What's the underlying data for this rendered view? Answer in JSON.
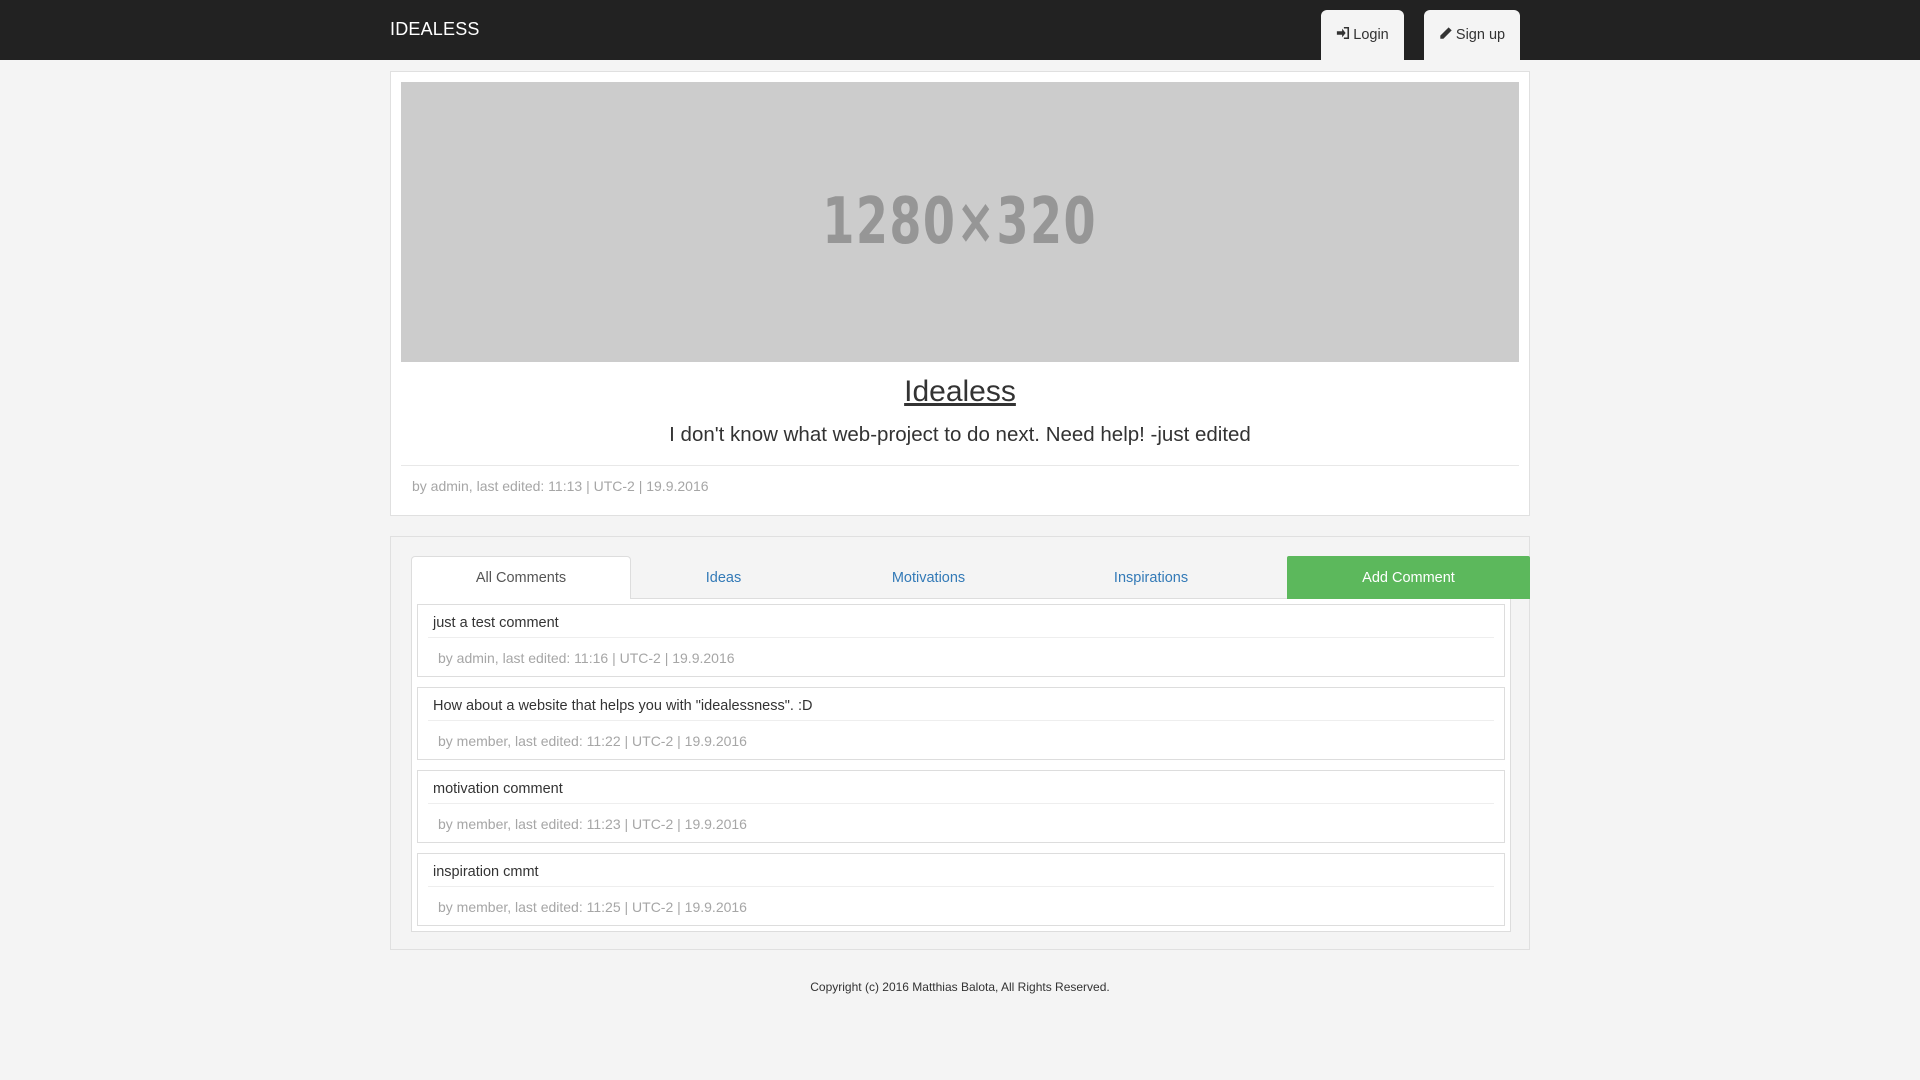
{
  "navbar": {
    "brand": "IDEALESS",
    "login_label": "Login",
    "signup_label": "Sign up",
    "login_icon": "login-icon",
    "signup_icon": "pencil-icon",
    "background": "#222222"
  },
  "idea": {
    "image_placeholder": "1280×320",
    "title": "Idealess",
    "description": "I don't know what web-project to do next. Need help! -just edited",
    "meta": "by admin, last edited: 11:13 | UTC-2 | 19.9.2016"
  },
  "tabs": {
    "items": [
      {
        "label": "All Comments",
        "active": true
      },
      {
        "label": "Ideas",
        "active": false
      },
      {
        "label": "Motivations",
        "active": false
      },
      {
        "label": "Inspirations",
        "active": false
      }
    ],
    "add_comment_label": "Add Comment",
    "add_comment_color": "#5cb85c",
    "link_color": "#337ab7"
  },
  "comments": [
    {
      "text": "just a test comment",
      "meta": "by admin, last edited: 11:16 | UTC-2 | 19.9.2016"
    },
    {
      "text": "How about a website that helps you with \"idealessness\". :D",
      "meta": "by member, last edited: 11:22 | UTC-2 | 19.9.2016"
    },
    {
      "text": "motivation comment",
      "meta": "by member, last edited: 11:23 | UTC-2 | 19.9.2016"
    },
    {
      "text": "inspiration cmmt",
      "meta": "by member, last edited: 11:25 | UTC-2 | 19.9.2016"
    }
  ],
  "footer": {
    "copyright": "Copyright (c) 2016 Matthias Balota, All Rights Reserved."
  }
}
